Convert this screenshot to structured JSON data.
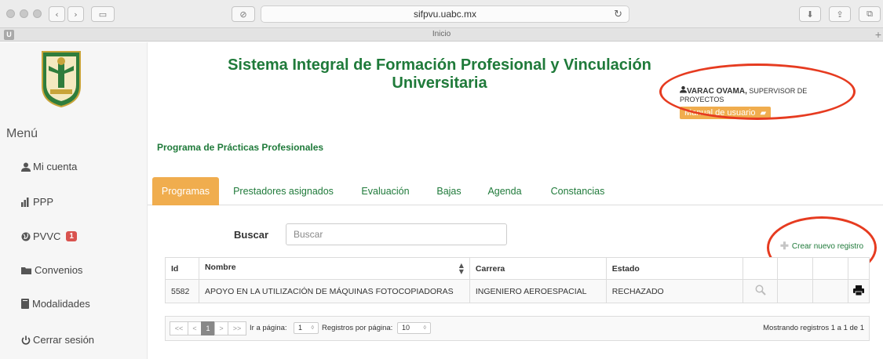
{
  "browser": {
    "url": "sifpvu.uabc.mx",
    "tab_title": "Inicio",
    "favicon_letter": "U"
  },
  "site": {
    "title_line1": "Sistema Integral de Formación Profesional y Vinculación",
    "title_line2": "Universitaria"
  },
  "user": {
    "name": "VARAC OVAMA,",
    "role": " SUPERVISOR DE PROYECTOS",
    "manual_label": "Manual de usuario"
  },
  "sidebar": {
    "title": "Menú",
    "items": [
      {
        "label": "Mi cuenta",
        "icon": "user-icon"
      },
      {
        "label": "PPP",
        "icon": "bar-chart-icon"
      },
      {
        "label": "PVVC",
        "icon": "globe-icon",
        "badge": "1"
      },
      {
        "label": "Convenios",
        "icon": "folder-icon"
      },
      {
        "label": "Modalidades",
        "icon": "book-icon"
      },
      {
        "label": "Cerrar sesión",
        "icon": "power-icon"
      }
    ]
  },
  "main": {
    "program_title": "Programa de Prácticas Profesionales",
    "tabs": [
      {
        "label": "Programas",
        "active": true
      },
      {
        "label": "Prestadores asignados"
      },
      {
        "label": "Evaluación"
      },
      {
        "label": "Bajas"
      },
      {
        "label": "Agenda"
      },
      {
        "label": "Constancias"
      }
    ],
    "search": {
      "label": "Buscar",
      "placeholder": "Buscar"
    },
    "create_label": "Crear nuevo registro",
    "table": {
      "columns": [
        "Id",
        "Nombre",
        "Carrera",
        "Estado"
      ],
      "rows": [
        {
          "id": "5582",
          "nombre": "APOYO EN LA UTILIZACIÓN DE MÁQUINAS FOTOCOPIADORAS",
          "carrera": "INGENIERO AEROESPACIAL",
          "estado": "RECHAZADO"
        }
      ]
    },
    "pager": {
      "first": "<<",
      "prev": "<",
      "current_page": "1",
      "next": ">",
      "last": ">>",
      "goto_label": "Ir a página:",
      "goto_value": "1",
      "per_page_label": "Registros por página:",
      "per_page_value": "10",
      "info": "Mostrando registros 1 a 1 de 1"
    }
  },
  "colors": {
    "brand_green": "#1f7a3a",
    "accent_orange": "#f0ad4e",
    "annotation_red": "#e63b20",
    "badge_red": "#d9534f"
  }
}
